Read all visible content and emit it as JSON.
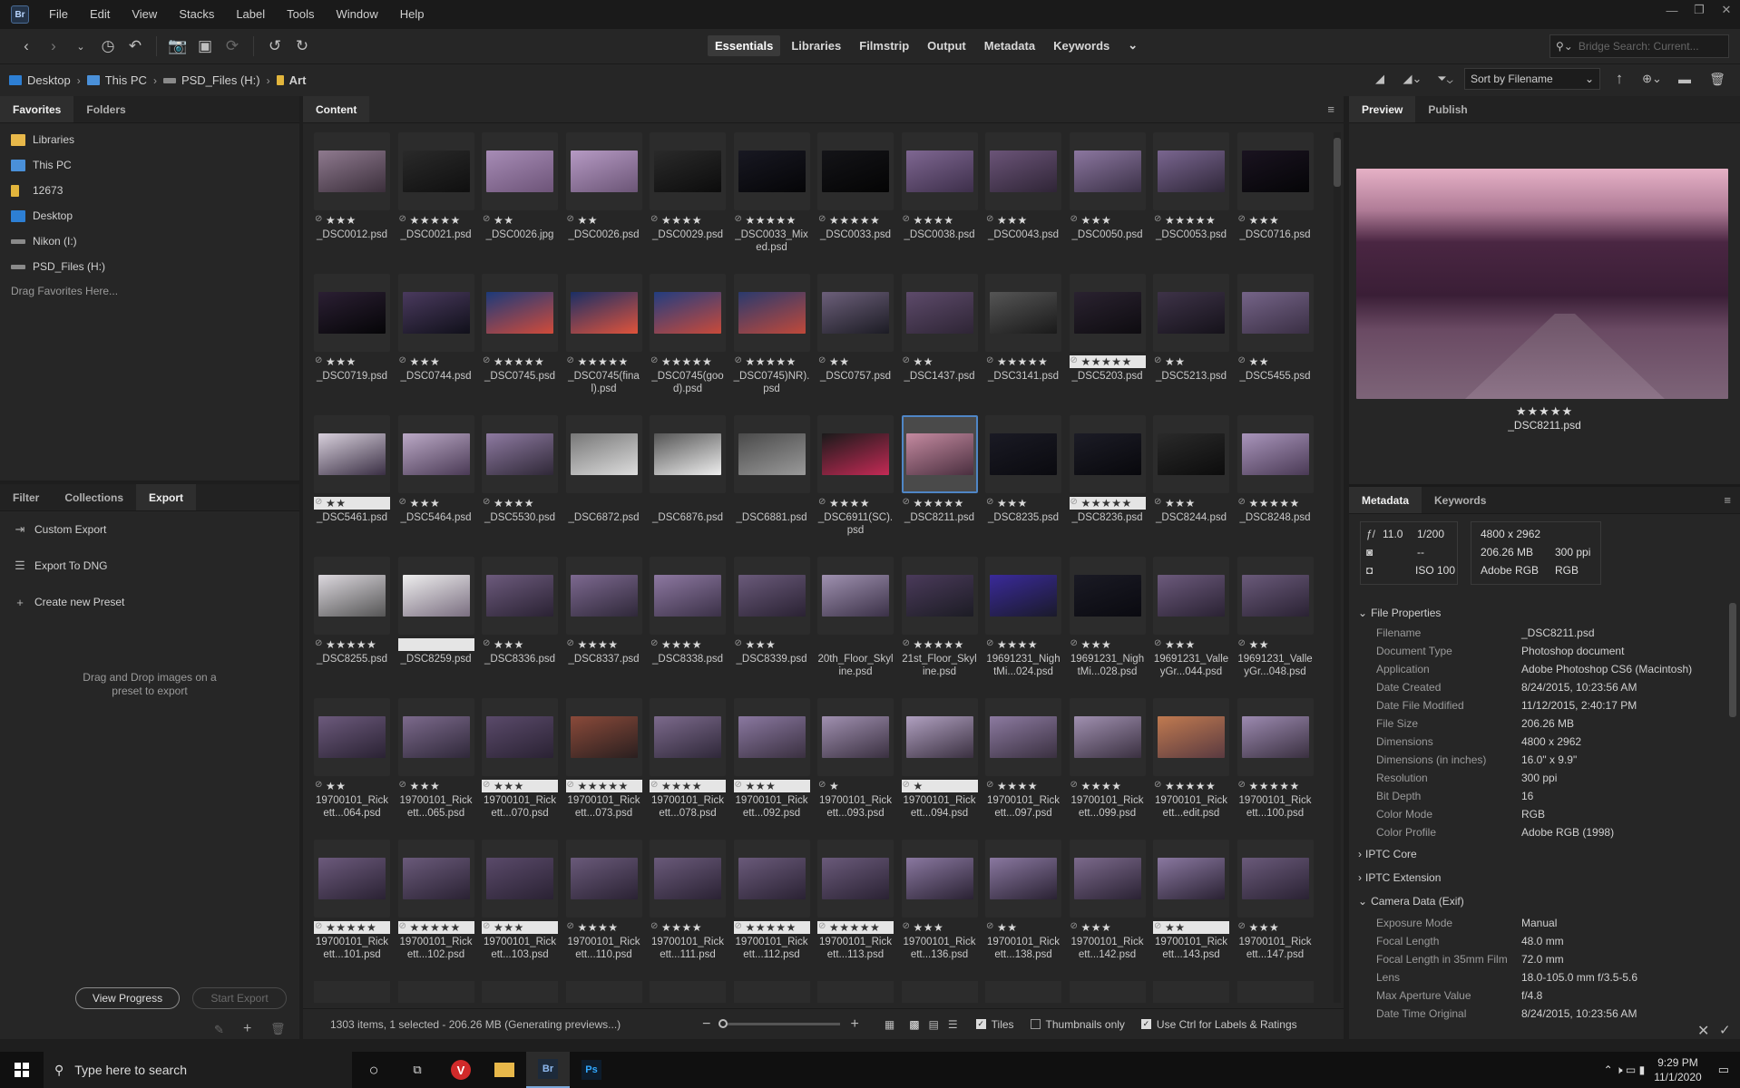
{
  "menu": {
    "logo": "Br",
    "items": [
      "File",
      "Edit",
      "View",
      "Stacks",
      "Label",
      "Tools",
      "Window",
      "Help"
    ]
  },
  "workspaces": [
    "Essentials",
    "Libraries",
    "Filmstrip",
    "Output",
    "Metadata",
    "Keywords"
  ],
  "search": {
    "placeholder": "Bridge Search: Current..."
  },
  "path": [
    "Desktop",
    "This PC",
    "PSD_Files (H:)",
    "Art"
  ],
  "sort": {
    "label": "Sort by Filename"
  },
  "favorites": {
    "tabs": [
      "Favorites",
      "Folders"
    ],
    "items": [
      "Libraries",
      "This PC",
      "12673",
      "Desktop",
      "Nikon (I:)",
      "PSD_Files (H:)"
    ],
    "hint": "Drag Favorites Here..."
  },
  "export_panel": {
    "tabs": [
      "Filter",
      "Collections",
      "Export"
    ],
    "items": [
      "Custom Export",
      "Export To DNG",
      "Create new Preset"
    ],
    "hint": "Drag and Drop images on a preset to export",
    "view_progress": "View Progress",
    "start_export": "Start Export"
  },
  "content": {
    "tab": "Content",
    "rows": [
      [
        [
          "★★★",
          "_DSC0012.psd"
        ],
        [
          "★★★★★",
          "_DSC0021.psd"
        ],
        [
          "★★",
          "_DSC0026.jpg"
        ],
        [
          "★★",
          "_DSC0026.psd"
        ],
        [
          "★★★★",
          "_DSC0029.psd"
        ],
        [
          "★★★★★",
          "_DSC0033_Mixed.psd"
        ],
        [
          "★★★★★",
          "_DSC0033.psd"
        ],
        [
          "★★★★",
          "_DSC0038.psd"
        ],
        [
          "★★★",
          "_DSC0043.psd"
        ],
        [
          "★★★",
          "_DSC0050.psd"
        ],
        [
          "★★★★★",
          "_DSC0053.psd"
        ],
        [
          "★★★",
          "_DSC0716.psd"
        ]
      ],
      [
        [
          "★★★",
          "_DSC0719.psd"
        ],
        [
          "★★★",
          "_DSC0744.psd"
        ],
        [
          "★★★★★",
          "_DSC0745.psd"
        ],
        [
          "★★★★★",
          "_DSC0745(final).psd"
        ],
        [
          "★★★★★",
          "_DSC0745(good).psd"
        ],
        [
          "★★★★★",
          "_DSC0745)NR).psd"
        ],
        [
          "★★",
          "_DSC0757.psd"
        ],
        [
          "★★",
          "_DSC1437.psd"
        ],
        [
          "★★★★★",
          "_DSC3141.psd"
        ],
        [
          "★★★★★",
          "_DSC5203.psd"
        ],
        [
          "★★",
          "_DSC5213.psd"
        ],
        [
          "★★",
          "_DSC5455.psd"
        ]
      ],
      [
        [
          "★★",
          "_DSC5461.psd"
        ],
        [
          "★★★",
          "_DSC5464.psd"
        ],
        [
          "★★★★",
          "_DSC5530.psd"
        ],
        [
          "",
          "_DSC6872.psd"
        ],
        [
          "",
          "_DSC6876.psd"
        ],
        [
          "",
          "_DSC6881.psd"
        ],
        [
          "★★★★",
          "_DSC6911(SC).psd"
        ],
        [
          "★★★★★",
          "_DSC8211.psd"
        ],
        [
          "★★★",
          "_DSC8235.psd"
        ],
        [
          "★★★★★",
          "_DSC8236.psd"
        ],
        [
          "★★★",
          "_DSC8244.psd"
        ],
        [
          "★★★★★",
          "_DSC8248.psd"
        ]
      ],
      [
        [
          "★★★★★",
          "_DSC8255.psd"
        ],
        [
          "",
          "_DSC8259.psd"
        ],
        [
          "★★★",
          "_DSC8336.psd"
        ],
        [
          "★★★★",
          "_DSC8337.psd"
        ],
        [
          "★★★★",
          "_DSC8338.psd"
        ],
        [
          "★★★",
          "_DSC8339.psd"
        ],
        [
          "",
          "20th_Floor_Skyline.psd"
        ],
        [
          "★★★★★",
          "21st_Floor_Skyline.psd"
        ],
        [
          "★★★★",
          "19691231_NightMi...024.psd"
        ],
        [
          "★★★",
          "19691231_NightMi...028.psd"
        ],
        [
          "★★★",
          "19691231_ValleyGr...044.psd"
        ],
        [
          "★★",
          "19691231_ValleyGr...048.psd"
        ]
      ],
      [
        [
          "★★",
          "19700101_Rickett...064.psd"
        ],
        [
          "★★★",
          "19700101_Rickett...065.psd"
        ],
        [
          "★★★",
          "19700101_Rickett...070.psd"
        ],
        [
          "★★★★★",
          "19700101_Rickett...073.psd"
        ],
        [
          "★★★★",
          "19700101_Rickett...078.psd"
        ],
        [
          "★★★",
          "19700101_Rickett...092.psd"
        ],
        [
          "★",
          "19700101_Rickett...093.psd"
        ],
        [
          "★",
          "19700101_Rickett...094.psd"
        ],
        [
          "★★★★",
          "19700101_Rickett...097.psd"
        ],
        [
          "★★★★",
          "19700101_Rickett...099.psd"
        ],
        [
          "★★★★★",
          "19700101_Rickett...edit.psd"
        ],
        [
          "★★★★★",
          "19700101_Rickett...100.psd"
        ]
      ],
      [
        [
          "★★★★★",
          "19700101_Rickett...101.psd"
        ],
        [
          "★★★★★",
          "19700101_Rickett...102.psd"
        ],
        [
          "★★★",
          "19700101_Rickett...103.psd"
        ],
        [
          "★★★★",
          "19700101_Rickett...110.psd"
        ],
        [
          "★★★★",
          "19700101_Rickett...111.psd"
        ],
        [
          "★★★★★",
          "19700101_Rickett...112.psd"
        ],
        [
          "★★★★★",
          "19700101_Rickett...113.psd"
        ],
        [
          "★★★",
          "19700101_Rickett...136.psd"
        ],
        [
          "★★",
          "19700101_Rickett...138.psd"
        ],
        [
          "★★★",
          "19700101_Rickett...142.psd"
        ],
        [
          "★★",
          "19700101_Rickett...143.psd"
        ],
        [
          "★★★",
          "19700101_Rickett...147.psd"
        ]
      ]
    ]
  },
  "status": {
    "text": "1303 items, 1 selected - 206.26 MB (Generating previews...)",
    "tiles": "Tiles",
    "thumbs_only": "Thumbnails only",
    "use_ctrl": "Use Ctrl for Labels & Ratings"
  },
  "preview": {
    "tabs": [
      "Preview",
      "Publish"
    ],
    "stars": "★★★★★",
    "filename": "_DSC8211.psd"
  },
  "metadata": {
    "tabs": [
      "Metadata",
      "Keywords"
    ],
    "summary": {
      "fstop": "11.0",
      "shutter": "1/200",
      "dash": "--",
      "iso": "100",
      "dims": "4800 x 2962",
      "size": "206.26 MB",
      "ppi": "300 ppi",
      "profile": "Adobe RGB",
      "mode": "RGB"
    },
    "file_props_title": "File Properties",
    "file_props": [
      [
        "Filename",
        "_DSC8211.psd"
      ],
      [
        "Document Type",
        "Photoshop document"
      ],
      [
        "Application",
        "Adobe Photoshop CS6 (Macintosh)"
      ],
      [
        "Date Created",
        "8/24/2015, 10:23:56 AM"
      ],
      [
        "Date File Modified",
        "11/12/2015, 2:40:17 PM"
      ],
      [
        "File Size",
        "206.26 MB"
      ],
      [
        "Dimensions",
        "4800 x 2962"
      ],
      [
        "Dimensions (in inches)",
        "16.0\" x 9.9\""
      ],
      [
        "Resolution",
        "300 ppi"
      ],
      [
        "Bit Depth",
        "16"
      ],
      [
        "Color Mode",
        "RGB"
      ],
      [
        "Color Profile",
        "Adobe RGB (1998)"
      ]
    ],
    "iptc_core": "IPTC Core",
    "iptc_ext": "IPTC Extension",
    "camera_title": "Camera Data (Exif)",
    "camera": [
      [
        "Exposure Mode",
        "Manual"
      ],
      [
        "Focal Length",
        "48.0 mm"
      ],
      [
        "Focal Length in 35mm Film",
        "72.0 mm"
      ],
      [
        "Lens",
        "18.0-105.0 mm f/3.5-5.6"
      ],
      [
        "Max Aperture Value",
        "f/4.8"
      ],
      [
        "Date Time Original",
        "8/24/2015, 10:23:56 AM"
      ]
    ]
  },
  "taskbar": {
    "search": "Type here to search",
    "time": "9:29 PM",
    "date": "11/1/2020"
  }
}
